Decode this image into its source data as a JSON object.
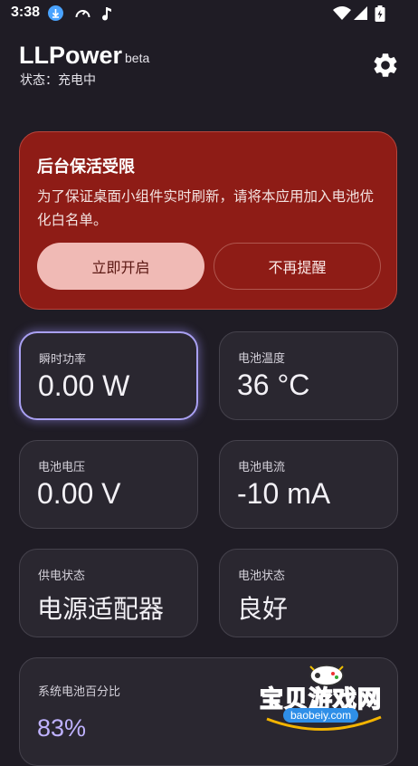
{
  "status_bar": {
    "time": "3:38",
    "icons": [
      "download-icon",
      "gauge-icon",
      "music-note-icon",
      "wifi-icon",
      "signal-icon",
      "battery-charging-icon"
    ]
  },
  "header": {
    "title": "LLPower",
    "badge": "beta",
    "status_text": "状态：充电中"
  },
  "warning": {
    "title": "后台保活受限",
    "description": "为了保证桌面小组件实时刷新，请将本应用加入电池优化白名单。",
    "primary_button": "立即开启",
    "secondary_button": "不再提醒"
  },
  "stats": [
    {
      "label": "瞬时功率",
      "value": "0.00 W"
    },
    {
      "label": "电池温度",
      "value": "36 °C"
    },
    {
      "label": "电池电压",
      "value": "0.00 V"
    },
    {
      "label": "电池电流",
      "value": "-10 mA"
    },
    {
      "label": "供电状态",
      "value": "电源适配器"
    },
    {
      "label": "电池状态",
      "value": "良好"
    }
  ],
  "battery_percent": {
    "label": "系统电池百分比",
    "value": "83%"
  },
  "watermark": {
    "text": "宝贝游戏网",
    "url": "baobeiy.com"
  },
  "colors": {
    "background": "#1f1c25",
    "warning_card": "#8e1c16",
    "primary_button": "#f0bab5",
    "accent": "#a9a0f2",
    "percent_text": "#bfb2ff"
  }
}
